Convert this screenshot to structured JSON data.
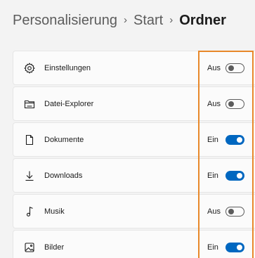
{
  "breadcrumb": {
    "items": [
      "Personalisierung",
      "Start",
      "Ordner"
    ],
    "separator": "›"
  },
  "folders": [
    {
      "label": "Einstellungen",
      "state": "Aus",
      "enabled": false,
      "icon": "gear-icon"
    },
    {
      "label": "Datei-Explorer",
      "state": "Aus",
      "enabled": false,
      "icon": "folder-icon"
    },
    {
      "label": "Dokumente",
      "state": "Ein",
      "enabled": true,
      "icon": "document-icon"
    },
    {
      "label": "Downloads",
      "state": "Ein",
      "enabled": true,
      "icon": "download-icon"
    },
    {
      "label": "Musik",
      "state": "Aus",
      "enabled": false,
      "icon": "music-icon"
    },
    {
      "label": "Bilder",
      "state": "Ein",
      "enabled": true,
      "icon": "image-icon"
    }
  ],
  "colors": {
    "accent": "#0067c0",
    "highlight": "#e8882a"
  }
}
